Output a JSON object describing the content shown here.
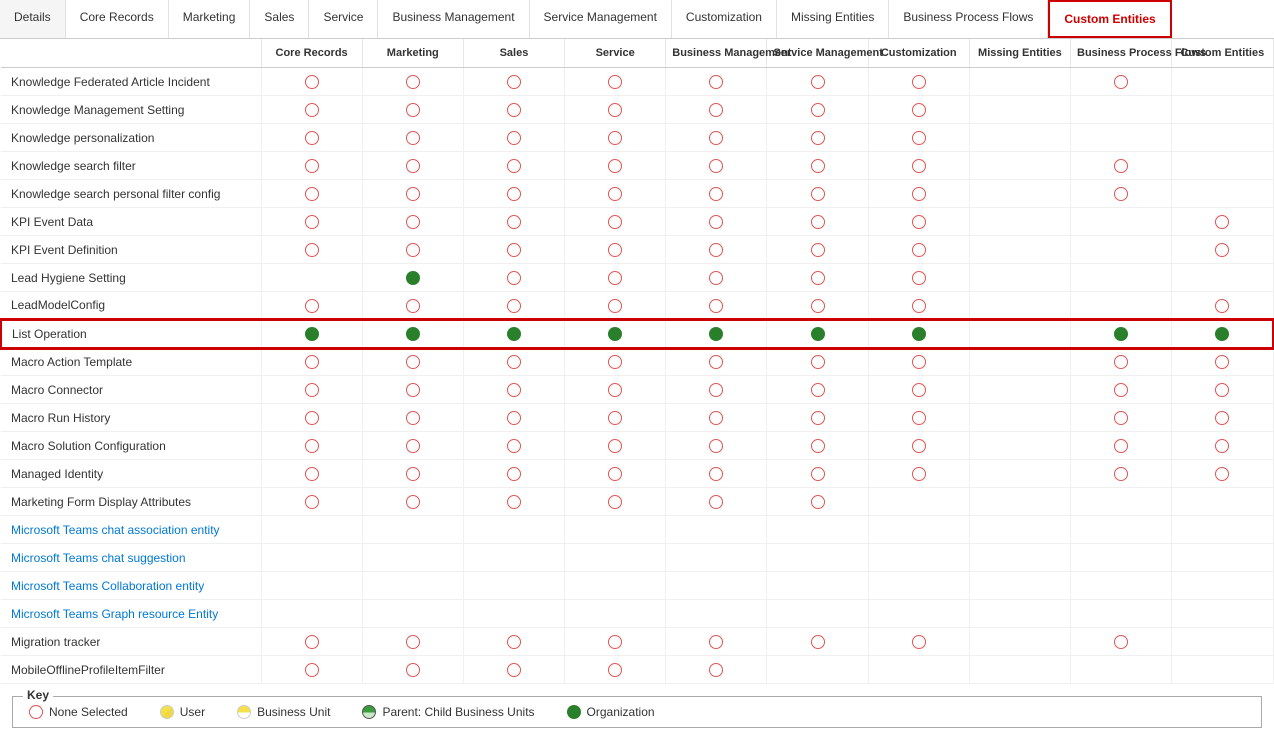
{
  "tabs": [
    {
      "label": "Details",
      "active": false,
      "highlighted": false
    },
    {
      "label": "Core Records",
      "active": false,
      "highlighted": false
    },
    {
      "label": "Marketing",
      "active": false,
      "highlighted": false
    },
    {
      "label": "Sales",
      "active": false,
      "highlighted": false
    },
    {
      "label": "Service",
      "active": false,
      "highlighted": false
    },
    {
      "label": "Business Management",
      "active": false,
      "highlighted": false
    },
    {
      "label": "Service Management",
      "active": false,
      "highlighted": false
    },
    {
      "label": "Customization",
      "active": false,
      "highlighted": false
    },
    {
      "label": "Missing Entities",
      "active": false,
      "highlighted": false
    },
    {
      "label": "Business Process Flows",
      "active": false,
      "highlighted": false
    },
    {
      "label": "Custom Entities",
      "active": false,
      "highlighted": true
    }
  ],
  "columns": [
    "Details",
    "Core Records",
    "Marketing",
    "Sales",
    "Service",
    "Business Management",
    "Service Management",
    "Customization",
    "Missing Entities",
    "Business Process Flows",
    "Custom Entities"
  ],
  "rows": [
    {
      "name": "Knowledge Federated Article Incident",
      "blue": false,
      "highlighted": false,
      "cells": [
        "E",
        "E",
        "E",
        "E",
        "E",
        "E",
        "E",
        "E",
        "",
        "E",
        ""
      ]
    },
    {
      "name": "Knowledge Management Setting",
      "blue": false,
      "highlighted": false,
      "cells": [
        "E",
        "E",
        "E",
        "E",
        "E",
        "E",
        "E",
        "E",
        "",
        "",
        ""
      ]
    },
    {
      "name": "Knowledge personalization",
      "blue": false,
      "highlighted": false,
      "cells": [
        "E",
        "E",
        "E",
        "E",
        "E",
        "E",
        "E",
        "E",
        "",
        "",
        ""
      ]
    },
    {
      "name": "Knowledge search filter",
      "blue": false,
      "highlighted": false,
      "cells": [
        "E",
        "E",
        "E",
        "E",
        "E",
        "E",
        "E",
        "E",
        "",
        "E",
        ""
      ]
    },
    {
      "name": "Knowledge search personal filter config",
      "blue": false,
      "highlighted": false,
      "cells": [
        "E",
        "E",
        "E",
        "E",
        "E",
        "E",
        "E",
        "E",
        "",
        "E",
        ""
      ]
    },
    {
      "name": "KPI Event Data",
      "blue": false,
      "highlighted": false,
      "cells": [
        "E",
        "E",
        "E",
        "E",
        "E",
        "E",
        "E",
        "E",
        "",
        "",
        "E"
      ]
    },
    {
      "name": "KPI Event Definition",
      "blue": false,
      "highlighted": false,
      "cells": [
        "E",
        "E",
        "E",
        "E",
        "E",
        "E",
        "E",
        "E",
        "",
        "",
        "E"
      ]
    },
    {
      "name": "Lead Hygiene Setting",
      "blue": false,
      "highlighted": false,
      "cells": [
        "E",
        "",
        "G",
        "E",
        "E",
        "E",
        "E",
        "E",
        "",
        "",
        ""
      ]
    },
    {
      "name": "LeadModelConfig",
      "blue": false,
      "highlighted": false,
      "cells": [
        "E",
        "E",
        "E",
        "E",
        "E",
        "E",
        "E",
        "E",
        "",
        "",
        "E"
      ]
    },
    {
      "name": "List Operation",
      "blue": false,
      "highlighted": true,
      "cells": [
        "E",
        "G",
        "G",
        "G",
        "G",
        "G",
        "G",
        "G",
        "",
        "G",
        "G"
      ]
    },
    {
      "name": "Macro Action Template",
      "blue": false,
      "highlighted": false,
      "cells": [
        "E",
        "E",
        "E",
        "E",
        "E",
        "E",
        "E",
        "E",
        "",
        "E",
        "E"
      ]
    },
    {
      "name": "Macro Connector",
      "blue": false,
      "highlighted": false,
      "cells": [
        "E",
        "E",
        "E",
        "E",
        "E",
        "E",
        "E",
        "E",
        "",
        "E",
        "E"
      ]
    },
    {
      "name": "Macro Run History",
      "blue": false,
      "highlighted": false,
      "cells": [
        "E",
        "E",
        "E",
        "E",
        "E",
        "E",
        "E",
        "E",
        "",
        "E",
        "E"
      ]
    },
    {
      "name": "Macro Solution Configuration",
      "blue": false,
      "highlighted": false,
      "cells": [
        "E",
        "E",
        "E",
        "E",
        "E",
        "E",
        "E",
        "E",
        "",
        "E",
        "E"
      ]
    },
    {
      "name": "Managed Identity",
      "blue": false,
      "highlighted": false,
      "cells": [
        "E",
        "E",
        "E",
        "E",
        "E",
        "E",
        "E",
        "E",
        "",
        "E",
        "E"
      ]
    },
    {
      "name": "Marketing Form Display Attributes",
      "blue": false,
      "highlighted": false,
      "cells": [
        "E",
        "E",
        "E",
        "E",
        "E",
        "E",
        "E",
        "",
        "",
        "",
        ""
      ]
    },
    {
      "name": "Microsoft Teams chat association entity",
      "blue": true,
      "highlighted": false,
      "cells": [
        "",
        "",
        "",
        "",
        "",
        "",
        "",
        "",
        "",
        "",
        ""
      ]
    },
    {
      "name": "Microsoft Teams chat suggestion",
      "blue": true,
      "highlighted": false,
      "cells": [
        "",
        "",
        "",
        "",
        "",
        "",
        "",
        "",
        "",
        "",
        ""
      ]
    },
    {
      "name": "Microsoft Teams Collaboration entity",
      "blue": true,
      "highlighted": false,
      "cells": [
        "",
        "",
        "",
        "",
        "",
        "",
        "",
        "",
        "",
        "",
        ""
      ]
    },
    {
      "name": "Microsoft Teams Graph resource Entity",
      "blue": true,
      "highlighted": false,
      "cells": [
        "",
        "",
        "",
        "",
        "",
        "",
        "",
        "",
        "",
        "",
        ""
      ]
    },
    {
      "name": "Migration tracker",
      "blue": false,
      "highlighted": false,
      "cells": [
        "E",
        "E",
        "E",
        "E",
        "E",
        "E",
        "E",
        "E",
        "",
        "E",
        ""
      ]
    },
    {
      "name": "MobileOfflineProfileItemFilter",
      "blue": false,
      "highlighted": false,
      "cells": [
        "E",
        "E",
        "E",
        "E",
        "E",
        "E",
        "",
        "",
        "",
        "",
        ""
      ]
    }
  ],
  "key": {
    "title": "Key",
    "items": [
      {
        "label": "None Selected",
        "type": "empty"
      },
      {
        "label": "User",
        "type": "half-user"
      },
      {
        "label": "Business Unit",
        "type": "half-bu"
      },
      {
        "label": "Parent: Child Business Units",
        "type": "half-parent"
      },
      {
        "label": "Organization",
        "type": "green"
      }
    ]
  }
}
